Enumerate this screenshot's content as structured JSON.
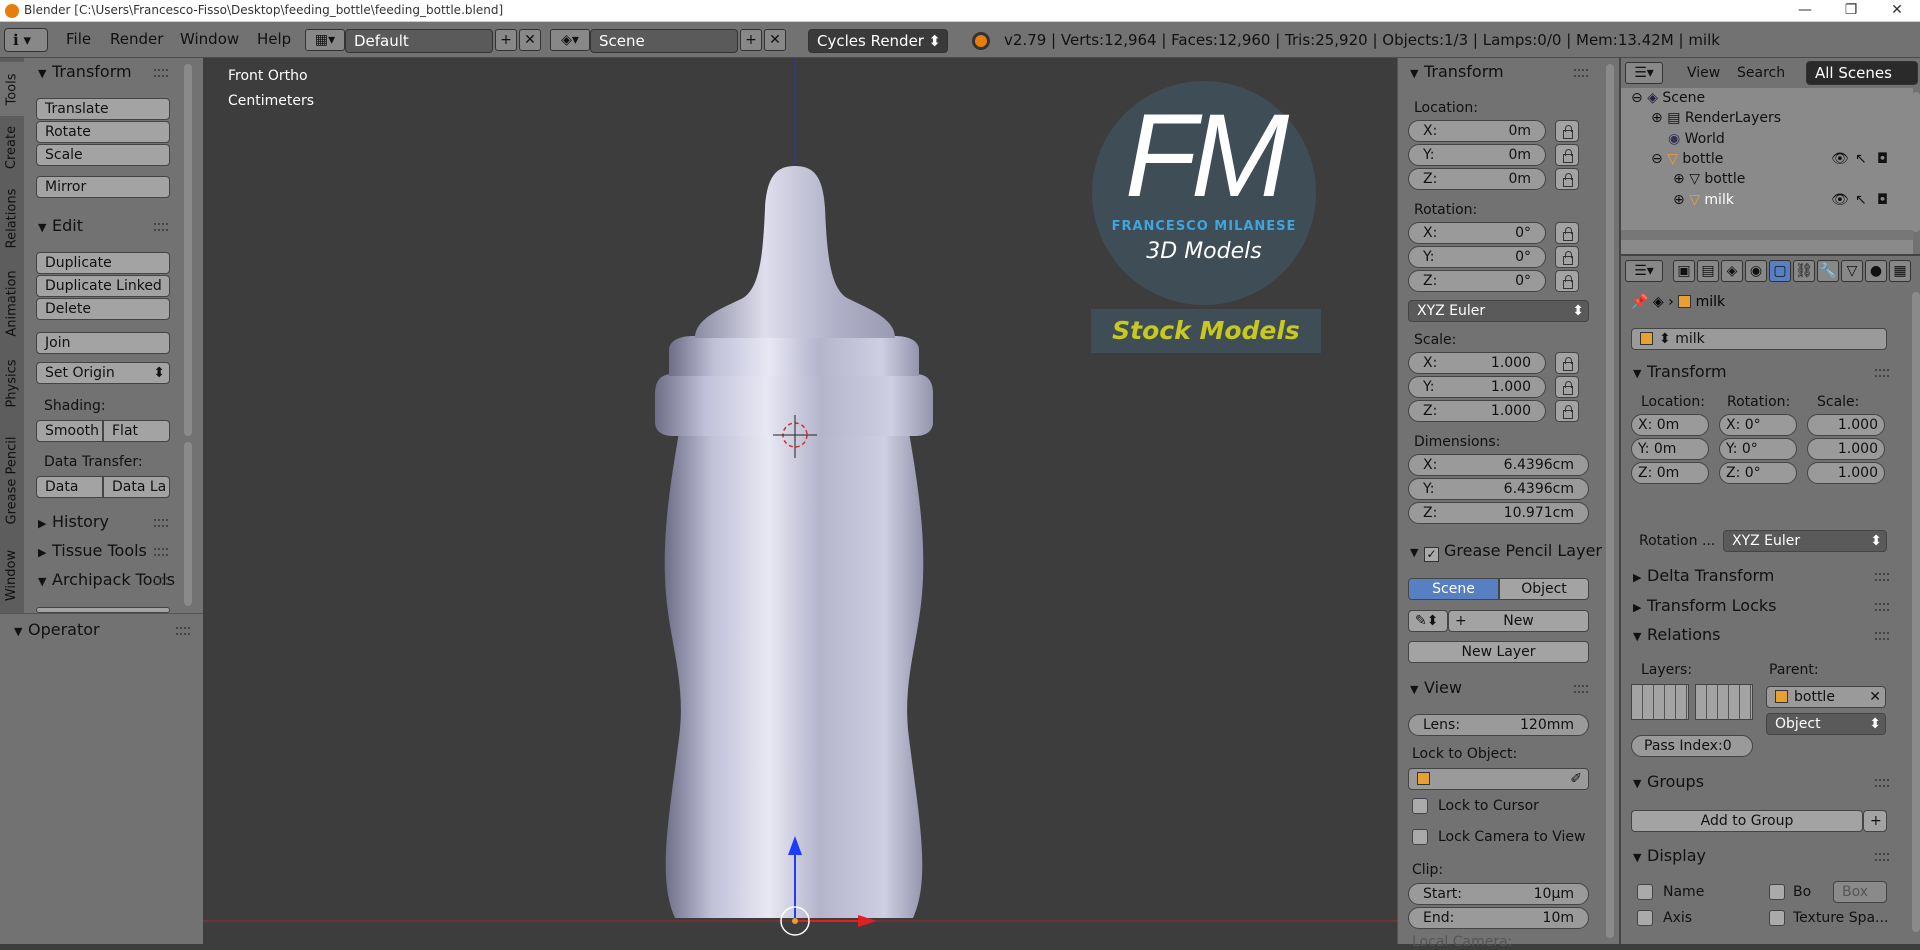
{
  "window": {
    "title": "Blender [C:\\Users\\Francesco-Fisso\\Desktop\\feeding_bottle\\feeding_bottle.blend]",
    "minimize": "—",
    "maximize": "❐",
    "close": "✕"
  },
  "menu": {
    "info_icon": "ℹ",
    "items": [
      "File",
      "Render",
      "Window",
      "Help"
    ],
    "layout": "Default",
    "scene": "Scene",
    "engine": "Cycles Render",
    "stats": "v2.79 | Verts:12,964 | Faces:12,960 | Tris:25,920 | Objects:1/3 | Lamps:0/0 | Mem:13.42M | milk"
  },
  "tool_tabs": [
    "Tools",
    "Create",
    "Relations",
    "Animation",
    "Physics",
    "Grease Pencil",
    "Window"
  ],
  "tools": {
    "transform_header": "Transform",
    "translate": "Translate",
    "rotate": "Rotate",
    "scale": "Scale",
    "mirror": "Mirror",
    "edit_header": "Edit",
    "duplicate": "Duplicate",
    "duplicate_linked": "Duplicate Linked",
    "delete": "Delete",
    "join": "Join",
    "set_origin": "Set Origin",
    "shading_label": "Shading:",
    "smooth": "Smooth",
    "flat": "Flat",
    "data_transfer_label": "Data Transfer:",
    "data": "Data",
    "data_la": "Data La",
    "history": "History",
    "tissue": "Tissue Tools",
    "archipack": "Archipack Tools",
    "operator": "Operator"
  },
  "viewport": {
    "view_name": "Front Ortho",
    "units": "Centimeters",
    "logo_letters": "FM",
    "logo_name": "FRANCESCO MILANESE",
    "logo_sub": "3D Models",
    "stock": "Stock Models"
  },
  "npanel": {
    "transform_header": "Transform",
    "location_label": "Location:",
    "loc": [
      {
        "axis": "X:",
        "value": "0m"
      },
      {
        "axis": "Y:",
        "value": "0m"
      },
      {
        "axis": "Z:",
        "value": "0m"
      }
    ],
    "rotation_label": "Rotation:",
    "rot": [
      {
        "axis": "X:",
        "value": "0°"
      },
      {
        "axis": "Y:",
        "value": "0°"
      },
      {
        "axis": "Z:",
        "value": "0°"
      }
    ],
    "rotation_mode": "XYZ Euler",
    "scale_label": "Scale:",
    "scale": [
      {
        "axis": "X:",
        "value": "1.000"
      },
      {
        "axis": "Y:",
        "value": "1.000"
      },
      {
        "axis": "Z:",
        "value": "1.000"
      }
    ],
    "dimensions_label": "Dimensions:",
    "dims": [
      {
        "axis": "X:",
        "value": "6.4396cm"
      },
      {
        "axis": "Y:",
        "value": "6.4396cm"
      },
      {
        "axis": "Z:",
        "value": "10.971cm"
      }
    ],
    "gp_header": "Grease Pencil Layer",
    "gp_scene": "Scene",
    "gp_object": "Object",
    "gp_new": "New",
    "gp_new_layer": "New Layer",
    "view_header": "View",
    "lens_label": "Lens:",
    "lens_value": "120mm",
    "lock_to_object": "Lock to Object:",
    "lock_to_cursor": "Lock to Cursor",
    "lock_camera": "Lock Camera to View",
    "clip_label": "Clip:",
    "clip_start_label": "Start:",
    "clip_start": "10µm",
    "clip_end_label": "End:",
    "clip_end": "10m",
    "local_camera": "Local Camera:"
  },
  "outliner": {
    "view": "View",
    "search": "Search",
    "all_scenes": "All Scenes",
    "tree": [
      "Scene",
      "RenderLayers",
      "World",
      "bottle",
      "bottle",
      "milk"
    ]
  },
  "props": {
    "breadcrumb_obj": "milk",
    "object_name": "milk",
    "transform_header": "Transform",
    "location_label": "Location:",
    "rotation_label": "Rotation:",
    "scale_label": "Scale:",
    "loc": [
      "X: 0m",
      "Y: 0m",
      "Z: 0m"
    ],
    "rot": [
      "X:   0°",
      "Y:   0°",
      "Z:   0°"
    ],
    "scale": [
      "1.000",
      "1.000",
      "1.000"
    ],
    "rotation_mode_label": "Rotation ...",
    "rotation_mode": "XYZ Euler",
    "delta": "Delta Transform",
    "locks": "Transform Locks",
    "relations": "Relations",
    "layers_label": "Layers:",
    "parent_label": "Parent:",
    "parent": "bottle",
    "parent_type": "Object",
    "pass_index": "Pass Index:0",
    "groups": "Groups",
    "add_to_group": "Add to Group",
    "display": "Display",
    "name": "Name",
    "bo": "Bo",
    "box": "Box",
    "axis": "Axis",
    "texture_space": "Texture Spa..."
  }
}
